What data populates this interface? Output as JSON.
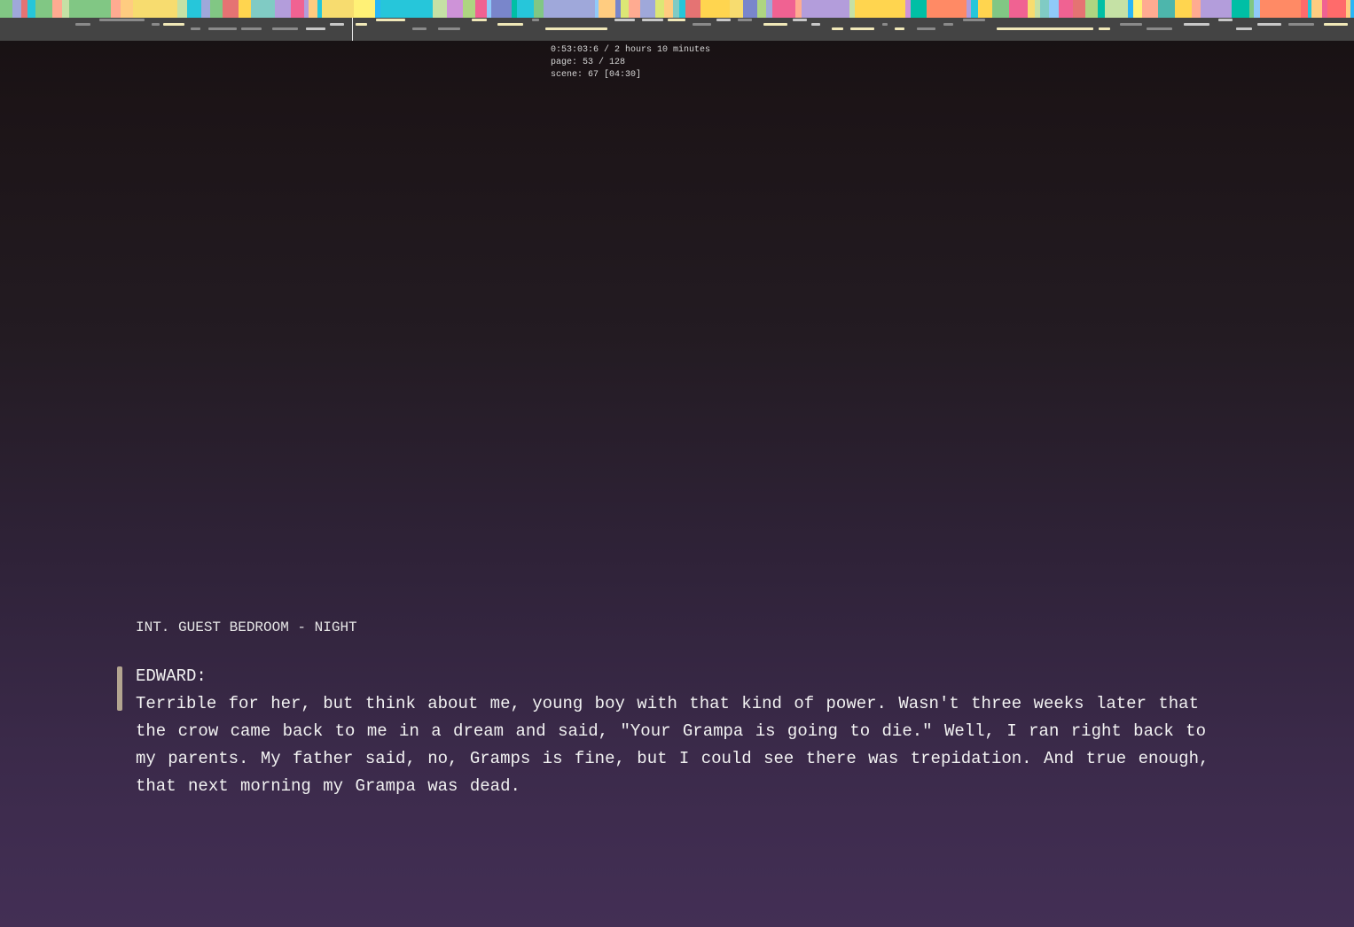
{
  "timeline": {
    "current_time": "0:53:03:6",
    "total_duration": "2 hours 10 minutes",
    "scene_colors": [
      "#ff6b6b",
      "#f7dc6f",
      "#c5e1a5",
      "#f48fb1",
      "#b39ddb",
      "#4db6ac",
      "#7986cb",
      "#81c784",
      "#ffcc80",
      "#ff8a65",
      "#29b6f6",
      "#fff176",
      "#80cbc4",
      "#ce93d8",
      "#ffab91",
      "#90caf9",
      "#aed581",
      "#ffd54f",
      "#9fa8da",
      "#e57373",
      "#26c6da",
      "#dce775",
      "#f06292",
      "#00bfa5"
    ],
    "playhead_fraction": 0.26
  },
  "info": {
    "time_line": "0:53:03:6 / 2 hours 10 minutes",
    "page_line": "page: 53 / 128",
    "scene_line": "scene: 67 [04:30]"
  },
  "script": {
    "scene_heading": "INT. GUEST BEDROOM - NIGHT",
    "character": "EDWARD:",
    "dialogue": "Terrible for her, but think about me, young boy with that kind of power. Wasn't three weeks later that the crow came back to me in a dream and said, \"Your Grampa is going to die.\" Well, I ran right back to my parents. My father said, no, Gramps is fine, but I could see there was trepidation. And true enough, that next morning my Grampa was dead."
  }
}
